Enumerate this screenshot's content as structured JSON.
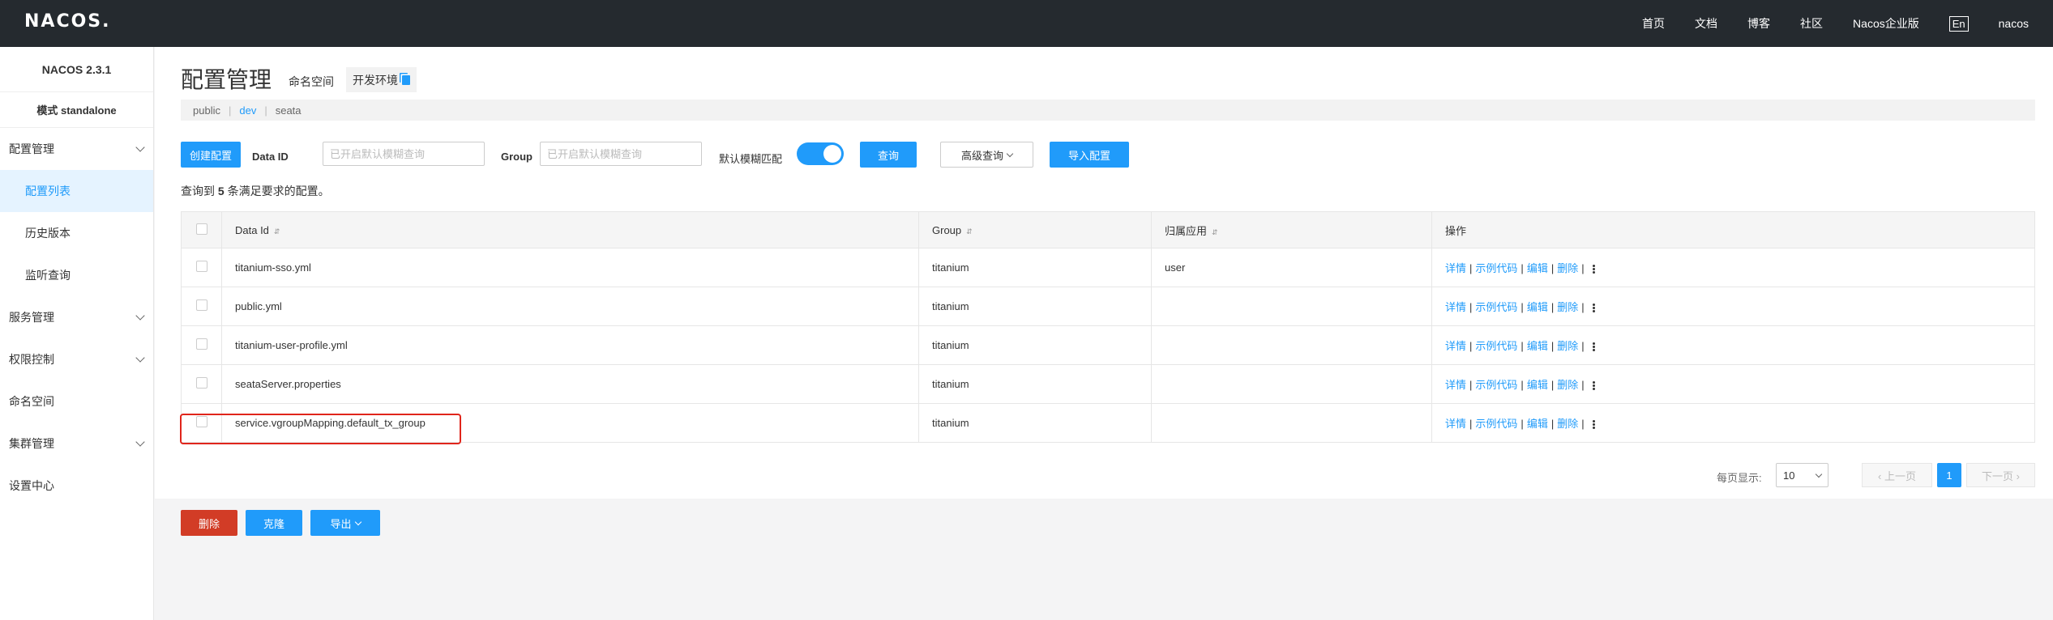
{
  "topbar": {
    "logo": "NACOS.",
    "nav": [
      "首页",
      "文档",
      "博客",
      "社区",
      "Nacos企业版"
    ],
    "lang": "En",
    "user": "nacos"
  },
  "sidebar": {
    "version": "NACOS 2.3.1",
    "mode": "模式 standalone",
    "config_group": "配置管理",
    "config_items": [
      "配置列表",
      "历史版本",
      "监听查询"
    ],
    "service_group": "服务管理",
    "auth_group": "权限控制",
    "namespace": "命名空间",
    "cluster_group": "集群管理",
    "settings": "设置中心"
  },
  "header": {
    "title": "配置管理",
    "namespace_label": "命名空间",
    "namespace_tag": "开发环境"
  },
  "namespaces": [
    "public",
    "dev",
    "seata"
  ],
  "filters": {
    "create_button": "创建配置",
    "data_id_label": "Data ID",
    "data_id_placeholder": "已开启默认模糊查询",
    "group_label": "Group",
    "group_placeholder": "已开启默认模糊查询",
    "fuzzy_label": "默认模糊匹配",
    "fuzzy_on": true,
    "query_button": "查询",
    "advanced_button": "高级查询",
    "import_button": "导入配置"
  },
  "result": {
    "prefix": "查询到",
    "count": "5",
    "suffix": "条满足要求的配置。"
  },
  "table": {
    "headers": [
      "Data Id",
      "Group",
      "归属应用",
      "操作"
    ],
    "sort_glyph": "⇵",
    "rows": [
      {
        "data_id": "titanium-sso.yml",
        "group": "titanium",
        "app": "user"
      },
      {
        "data_id": "public.yml",
        "group": "titanium",
        "app": ""
      },
      {
        "data_id": "titanium-user-profile.yml",
        "group": "titanium",
        "app": ""
      },
      {
        "data_id": "seataServer.properties",
        "group": "titanium",
        "app": ""
      },
      {
        "data_id": "service.vgroupMapping.default_tx_group",
        "group": "titanium",
        "app": ""
      }
    ],
    "ops": [
      "详情",
      "示例代码",
      "编辑",
      "删除"
    ],
    "pipe": "|"
  },
  "footer": {
    "delete_button": "删除",
    "clone_button": "克隆",
    "export_button": "导出",
    "page_size_label": "每页显示:",
    "page_size": "10",
    "prev": "‹ 上一页",
    "page": "1",
    "next": "下一页 ›"
  },
  "colors": {
    "primary": "#209bfa",
    "danger": "#d23c26",
    "topbar": "#252a2f",
    "highlight_box": "#e0251b"
  }
}
